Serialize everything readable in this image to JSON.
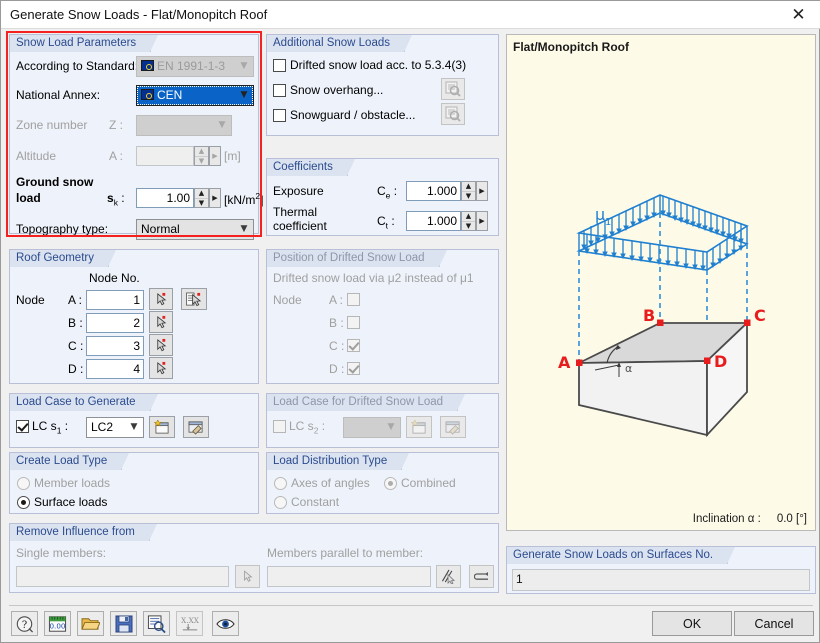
{
  "window": {
    "title": "Generate Snow Loads  -  Flat/Monopitch Roof",
    "close_icon": "close-icon"
  },
  "snow_load_parameters": {
    "group_title": "Snow Load Parameters",
    "standard_label": "According to Standard:",
    "standard_value": "EN 1991-1-3",
    "national_annex_label": "National Annex:",
    "national_annex_value": "CEN",
    "zone_label": "Zone number",
    "zone_symbol": "Z :",
    "zone_value": "",
    "altitude_label": "Altitude",
    "altitude_symbol": "A :",
    "altitude_value": "",
    "altitude_unit": "[m]",
    "ground_snow_label_1": "Ground snow",
    "ground_snow_label_2": "load",
    "ground_snow_symbol": "s",
    "ground_snow_symbol_sub": "k",
    "ground_snow_colon": " :",
    "ground_snow_value": "1.00",
    "ground_snow_unit_pre": "[kN/m",
    "ground_snow_unit_sup": "2",
    "ground_snow_unit_post": "]",
    "topography_label": "Topography type:",
    "topography_value": "Normal"
  },
  "additional_snow_loads": {
    "group_title": "Additional Snow Loads",
    "items": [
      {
        "label": "Drifted snow load acc. to 5.3.4(3)",
        "checked": false,
        "has_button": false
      },
      {
        "label": "Snow overhang...",
        "checked": false,
        "has_button": true
      },
      {
        "label": "Snowguard / obstacle...",
        "checked": false,
        "has_button": true
      }
    ]
  },
  "coefficients": {
    "group_title": "Coefficients",
    "exposure_label": "Exposure",
    "exposure_symbol": "C",
    "exposure_symbol_sub": "e",
    "exposure_value": "1.000",
    "thermal_label_1": "Thermal",
    "thermal_label_2": "coefficient",
    "thermal_symbol": "C",
    "thermal_symbol_sub": "t",
    "thermal_value": "1.000",
    "colon": " :"
  },
  "roof_geometry": {
    "group_title": "Roof Geometry",
    "column_header": "Node No.",
    "row_label": "Node",
    "rows": [
      {
        "name": "A :",
        "value": "1"
      },
      {
        "name": "B :",
        "value": "2"
      },
      {
        "name": "C :",
        "value": "3"
      },
      {
        "name": "D :",
        "value": "4"
      }
    ]
  },
  "position_drifted": {
    "group_title": "Position of Drifted Snow Load",
    "description": "Drifted snow load via μ2 instead of μ1",
    "row_label": "Node",
    "rows": [
      {
        "name": "A :",
        "checked": false
      },
      {
        "name": "B :",
        "checked": false
      },
      {
        "name": "C :",
        "checked": true
      },
      {
        "name": "D :",
        "checked": true
      }
    ]
  },
  "load_case_generate": {
    "group_title": "Load Case to Generate",
    "checkbox_checked": true,
    "label_pre": "LC s",
    "label_sub": "1",
    "label_post": " :",
    "value": "LC2",
    "new_icon": "new-load-case-icon",
    "edit_icon": "edit-load-case-icon"
  },
  "load_case_drifted": {
    "group_title": "Load Case for Drifted Snow Load",
    "checkbox_checked": false,
    "label_pre": "LC s",
    "label_sub": "2",
    "label_post": " :",
    "value": "",
    "new_icon": "new-load-case-icon",
    "edit_icon": "edit-load-case-icon"
  },
  "create_load_type": {
    "group_title": "Create Load Type",
    "options": [
      {
        "label": "Member loads",
        "selected": false,
        "disabled": true
      },
      {
        "label": "Surface loads",
        "selected": true,
        "disabled": false
      }
    ]
  },
  "load_distribution_type": {
    "group_title": "Load Distribution Type",
    "options": [
      {
        "label": "Axes of angles",
        "selected": false
      },
      {
        "label": "Combined",
        "selected": true
      },
      {
        "label": "Constant",
        "selected": false
      }
    ]
  },
  "remove_influence": {
    "group_title": "Remove Influence from",
    "single_members_label": "Single members:",
    "single_members_value": "",
    "parallel_label": "Members parallel to member:",
    "parallel_value": "",
    "pick_icon": "pick-member-icon",
    "pick_parallel_icon": "pick-parallel-member-icon",
    "arrow_icon": "arrow-member-icon"
  },
  "preview": {
    "label": "Flat/Monopitch Roof",
    "inclination_label": "Inclination",
    "inclination_symbol": "α :",
    "inclination_value": "0.0 [°]",
    "mu_label": "μ",
    "mu_sub": "1",
    "nodes": [
      "A",
      "B",
      "C",
      "D"
    ],
    "angle_label": "α"
  },
  "generate_surfaces": {
    "group_title": "Generate Snow Loads on Surfaces No.",
    "value": "1"
  },
  "toolbar": {
    "buttons": [
      {
        "icon": "help-icon"
      },
      {
        "icon": "units-icon"
      },
      {
        "icon": "open-folder-icon"
      },
      {
        "icon": "save-icon"
      },
      {
        "icon": "details-zoom-icon"
      },
      {
        "icon": "set-variable-icon"
      },
      {
        "icon": "visibility-eye-icon"
      }
    ]
  },
  "footer": {
    "ok_label": "OK",
    "cancel_label": "Cancel"
  },
  "colors": {
    "accent_blue": "#0a64c8",
    "group_title": "#2b4b8d",
    "highlight_red": "#f52121",
    "diagram_blue": "#1f7fd0",
    "node_red": "#e81c1c",
    "preview_bg": "#fdfbe8"
  }
}
